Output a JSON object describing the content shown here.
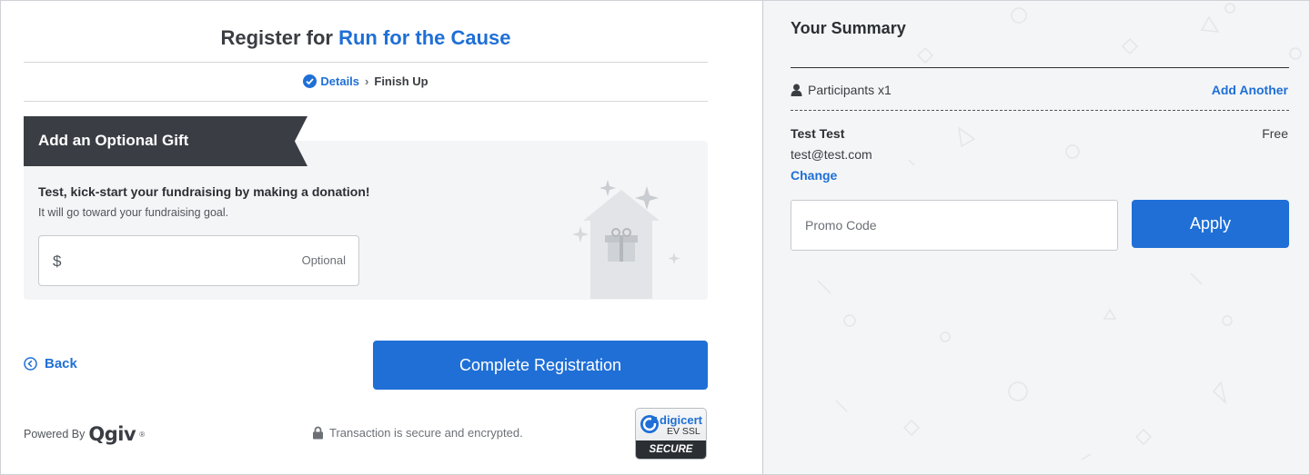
{
  "header": {
    "title_prefix": "Register for ",
    "event_name": "Run for the Cause"
  },
  "steps": {
    "done_label": "Details",
    "separator": "›",
    "current_label": "Finish Up"
  },
  "gift": {
    "ribbon_label": "Add an Optional Gift",
    "heading": "Test, kick-start your fundraising by making a donation!",
    "subtext": "It will go toward your fundraising goal.",
    "currency_symbol": "$",
    "amount_value": "",
    "optional_label": "Optional"
  },
  "actions": {
    "back_label": "Back",
    "complete_label": "Complete Registration"
  },
  "footer": {
    "powered_by": "Powered By",
    "logo_text": "Qgiv",
    "registered_mark": "®",
    "secure_text": "Transaction is secure and encrypted.",
    "badge_brand": "digicert",
    "badge_type": "EV SSL",
    "badge_secure": "SECURE"
  },
  "summary": {
    "title": "Your Summary",
    "participants_label": "Participants x1",
    "add_another_label": "Add Another",
    "participant": {
      "name": "Test Test",
      "price": "Free",
      "email": "test@test.com",
      "change_label": "Change"
    },
    "promo_placeholder": "Promo Code",
    "promo_value": "",
    "apply_label": "Apply"
  },
  "colors": {
    "accent": "#1f6fd6",
    "dark": "#3a3e44",
    "panel_bg": "#f4f5f7"
  }
}
